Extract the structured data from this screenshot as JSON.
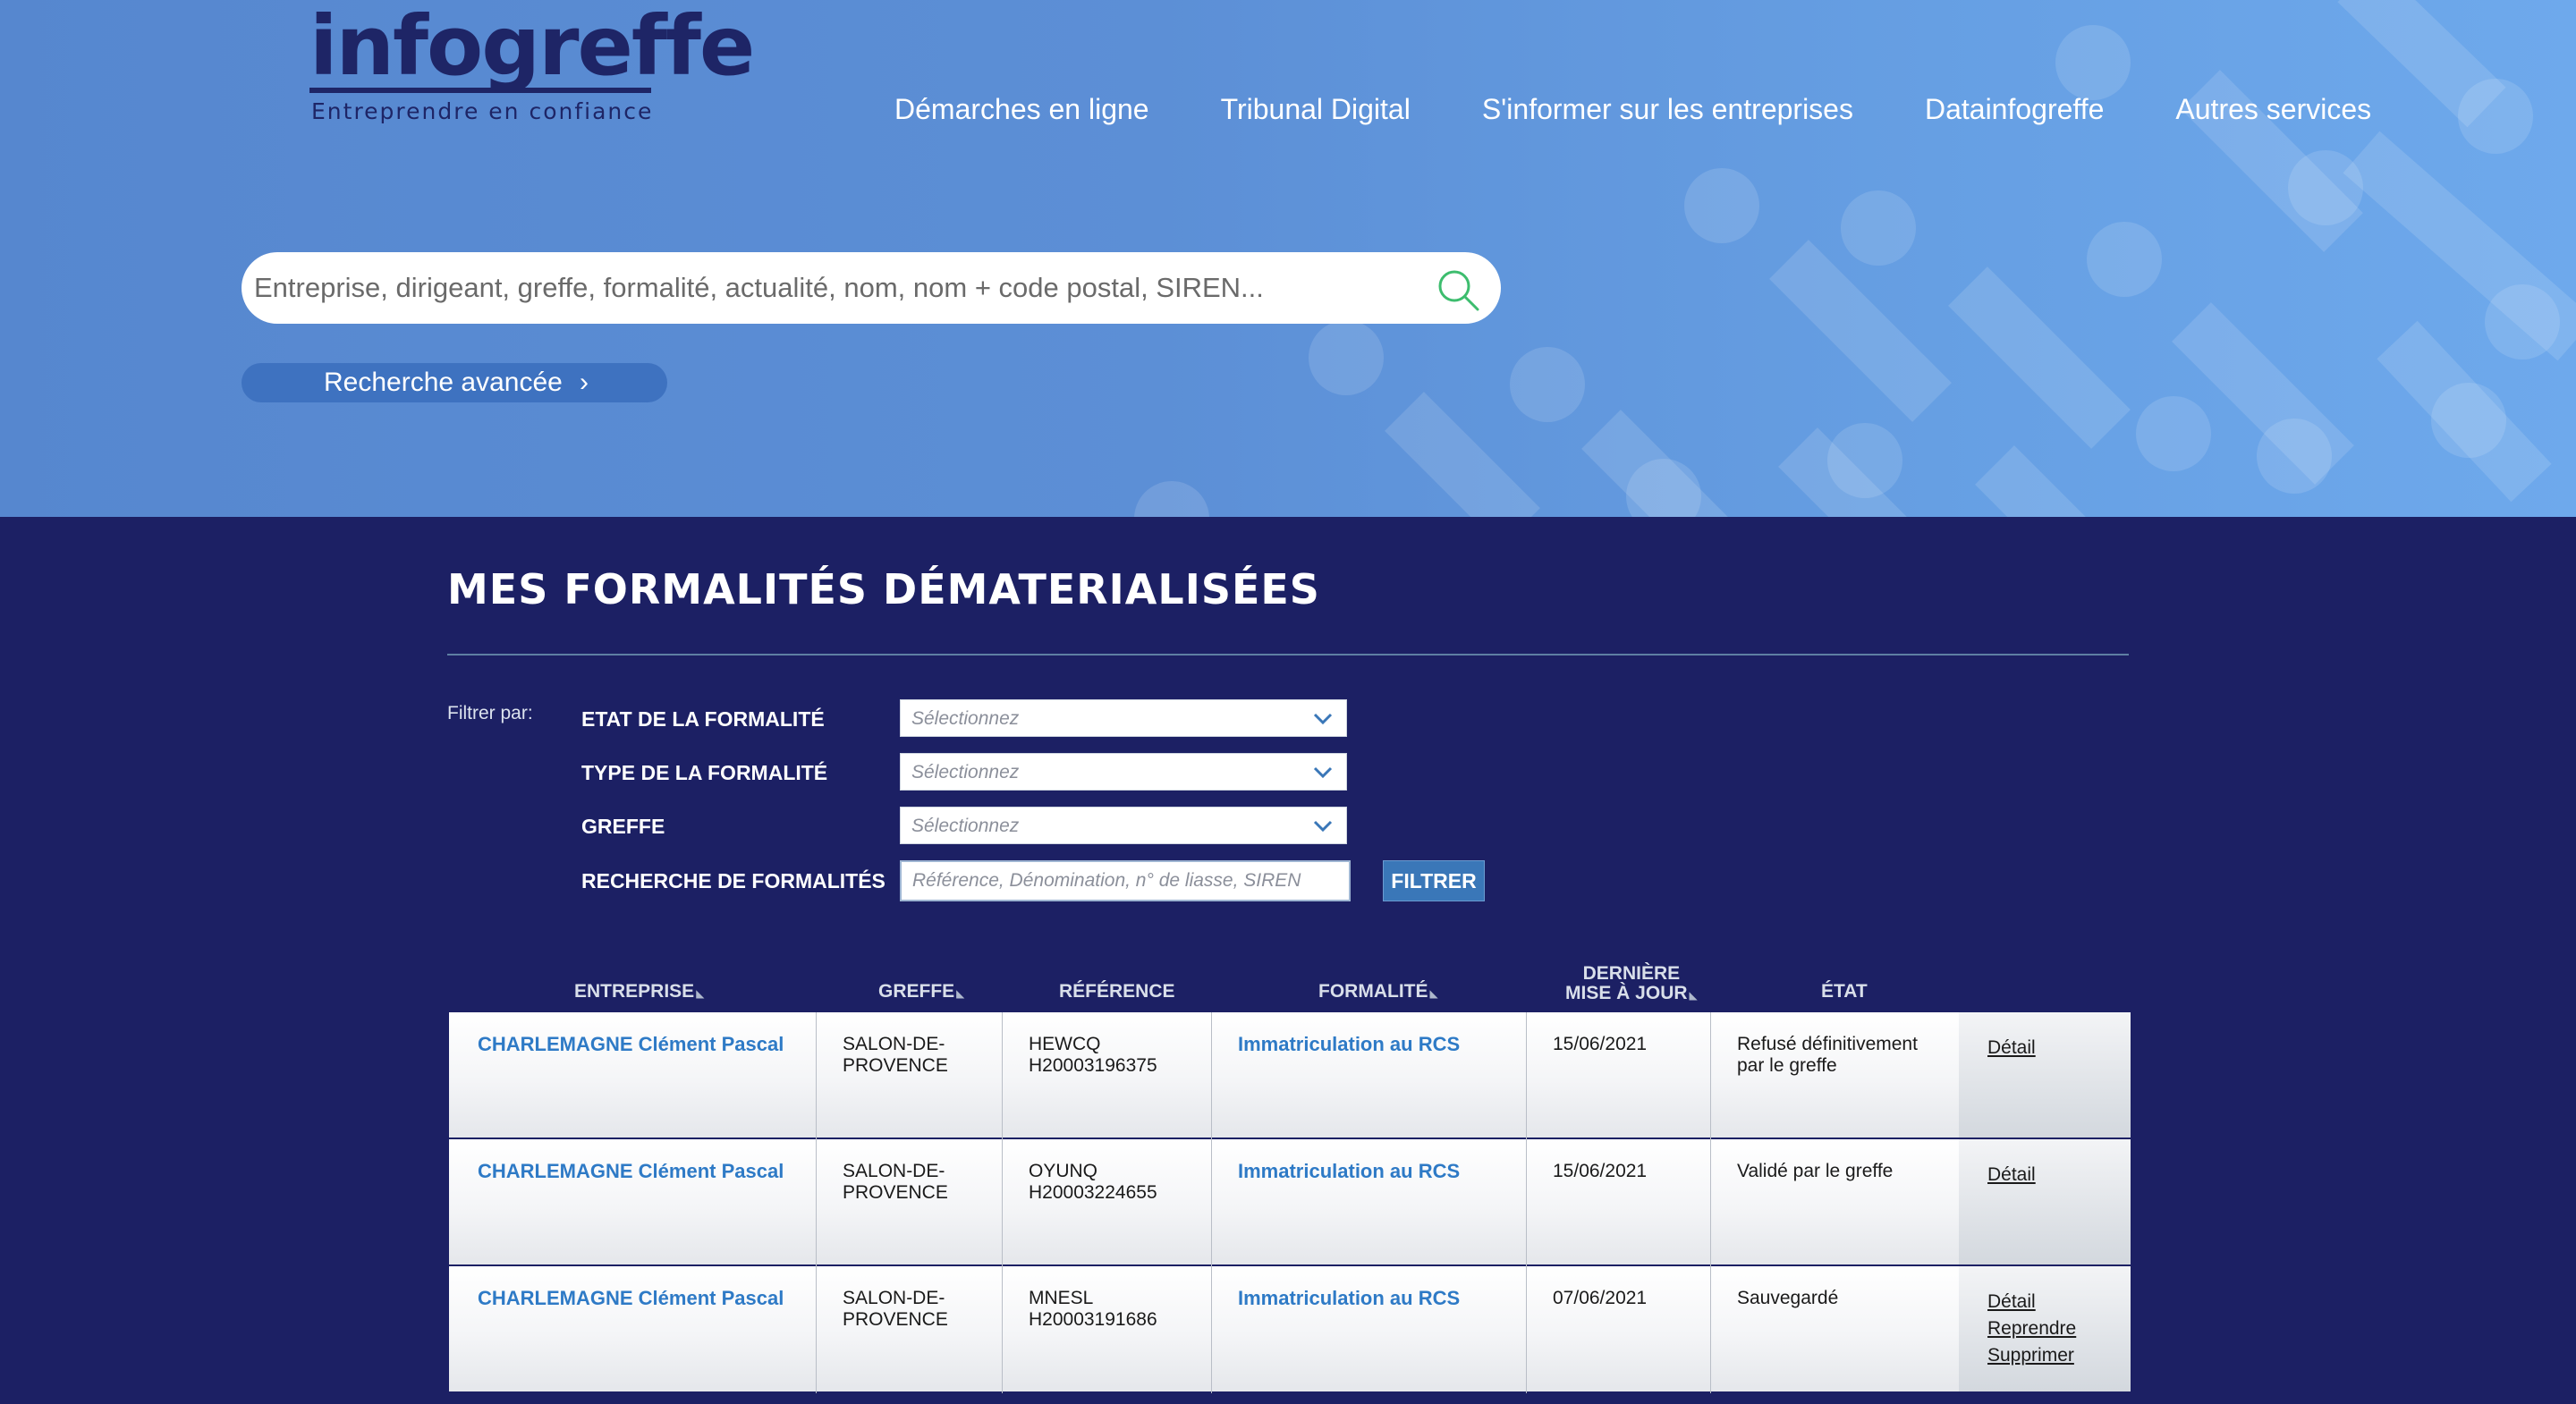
{
  "header": {
    "logo_word": "infogreffe",
    "logo_tagline": "Entreprendre en confiance",
    "nav": [
      "Démarches en ligne",
      "Tribunal Digital",
      "S'informer sur les entreprises",
      "Datainfogreffe",
      "Autres services"
    ]
  },
  "search": {
    "placeholder": "Entreprise, dirigeant, greffe, formalité, actualité, nom, nom + code postal, SIREN...",
    "advanced_label": "Recherche avancée"
  },
  "section": {
    "title": "MES FORMALITÉS DÉMATERIALISÉES"
  },
  "filters": {
    "label": "Filtrer par:",
    "state_label": "ETAT DE LA FORMALITÉ",
    "type_label": "TYPE DE LA FORMALITÉ",
    "greffe_label": "GREFFE",
    "search_label": "RECHERCHE DE FORMALITÉS",
    "select_placeholder": "Sélectionnez",
    "search_placeholder": "Référence, Dénomination, n° de liasse, SIREN",
    "filter_button": "FILTRER"
  },
  "table": {
    "headers": {
      "entreprise": "ENTREPRISE",
      "greffe": "GREFFE",
      "reference": "RÉFÉRENCE",
      "formalite": "FORMALITÉ",
      "date_line1": "DERNIÈRE",
      "date_line2": "MISE À JOUR",
      "etat": "ÉTAT"
    },
    "rows": [
      {
        "entreprise": "CHARLEMAGNE Clément Pascal",
        "greffe_line1": "SALON-DE-",
        "greffe_line2": "PROVENCE",
        "ref_code": "HEWCQ",
        "ref_number": "H20003196375",
        "formalite": "Immatriculation au RCS",
        "date": "15/06/2021",
        "etat_line1": "Refusé définitivement",
        "etat_line2": "par le greffe",
        "action_detail": "Détail"
      },
      {
        "entreprise": "CHARLEMAGNE Clément Pascal",
        "greffe_line1": "SALON-DE-",
        "greffe_line2": "PROVENCE",
        "ref_code": "OYUNQ",
        "ref_number": "H20003224655",
        "formalite": "Immatriculation au RCS",
        "date": "15/06/2021",
        "etat_line1": "Validé par le greffe",
        "etat_line2": "",
        "action_detail": "Détail"
      },
      {
        "entreprise": "CHARLEMAGNE Clément Pascal",
        "greffe_line1": "SALON-DE-",
        "greffe_line2": "PROVENCE",
        "ref_code": "MNESL",
        "ref_number": "H20003191686",
        "formalite": "Immatriculation au RCS",
        "date": "07/06/2021",
        "etat_line1": "Sauvegardé",
        "etat_line2": "",
        "action_detail": "Détail",
        "action_resume": "Reprendre",
        "action_delete": "Supprimer"
      }
    ]
  }
}
